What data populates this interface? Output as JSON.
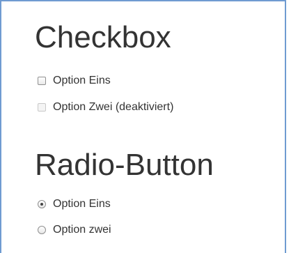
{
  "checkbox_section": {
    "title": "Checkbox",
    "options": [
      {
        "label": "Option Eins",
        "checked": false,
        "disabled": false
      },
      {
        "label": "Option Zwei (deaktiviert)",
        "checked": false,
        "disabled": true
      }
    ]
  },
  "radio_section": {
    "title": "Radio-Button",
    "options": [
      {
        "label": "Option Eins",
        "selected": true
      },
      {
        "label": "Option zwei",
        "selected": false
      }
    ]
  },
  "colors": {
    "text": "#333333",
    "panel_border": "#6f9bd1",
    "background": "#ffffff"
  }
}
